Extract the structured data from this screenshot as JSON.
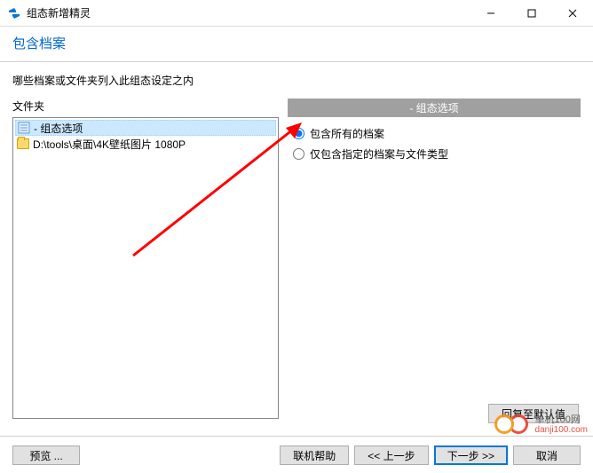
{
  "window": {
    "title": "组态新增精灵",
    "minimize": "—",
    "maximize": "☐",
    "close": "✕"
  },
  "header": {
    "title": "包含档案"
  },
  "instruction": "哪些档案或文件夹列入此组态设定之内",
  "leftPanel": {
    "label": "文件夹",
    "items": [
      {
        "label": "- 组态选项"
      },
      {
        "label": "D:\\tools\\桌面\\4K壁纸图片 1080P"
      }
    ]
  },
  "rightPanel": {
    "header": "- 组态选项",
    "options": [
      {
        "label": "包含所有的档案",
        "checked": true
      },
      {
        "label": "仅包含指定的档案与文件类型",
        "checked": false
      }
    ]
  },
  "buttons": {
    "reset": "回复至默认值",
    "preview": "预览 ...",
    "help": "联机帮助",
    "back": "<< 上一步",
    "next": "下一步 >>",
    "cancel": "取消"
  },
  "watermark": {
    "cn": "单机100网",
    "url": "danji100.com"
  }
}
